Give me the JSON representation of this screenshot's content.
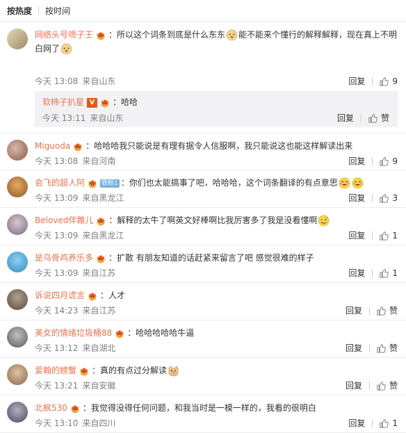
{
  "sort": {
    "hot": "按热度",
    "time": "按时间"
  },
  "labels": {
    "reply": "回复",
    "like": "赞"
  },
  "colors": {
    "username": "#eb7350",
    "meta": "#808080",
    "divider": "#ececec"
  },
  "comments": [
    {
      "user": "网络头号喷子王",
      "parts": [
        "所以这个词条到底是什么东东",
        "能不能来个懂行的解释解释，现在真上不明白网了"
      ],
      "emojis": [
        "doge-emoji",
        "doge-emoji"
      ],
      "time": "今天 13:08",
      "loc": "来自山东",
      "likes": "9",
      "reply": {
        "user": "软柿子扒星",
        "text": "：哈哈",
        "time": "今天 13:11",
        "loc": "来自山东"
      }
    },
    {
      "user": "Miguoda",
      "parts": [
        "：哈哈哈我只能说是有理有据令人信服啊，我只能说这也能这样解读出来"
      ],
      "time": "今天 13:08",
      "loc": "来自河南",
      "likes": "9"
    },
    {
      "user": "会飞的超人阿",
      "tag": "铁粉1",
      "parts": [
        "：你们也太能搞事了吧，哈哈哈，这个词条翻译的有点意思"
      ],
      "emojis": [
        "laugh-cry-emoji",
        "laugh-cry-emoji"
      ],
      "time": "今天 13:09",
      "loc": "来自黑龙江",
      "likes": "3"
    },
    {
      "user": "Beloved伴雛儿",
      "parts": [
        "：解释的太牛了啊英文好棒啊比我厉害多了我是没看懂啊"
      ],
      "emojis": [
        "sweat-emoji"
      ],
      "time": "今天 13:09",
      "loc": "来自黑龙江",
      "likes": "1"
    },
    {
      "user": "是乌骨鸡养乐多",
      "parts": [
        "：扩散 有朋友知道的话赶紧来留言了吧 感觉很难的样子"
      ],
      "time": "今天 13:09",
      "loc": "来自江苏",
      "likes": "1"
    },
    {
      "user": "诉说四月谎言",
      "parts": [
        "：人才"
      ],
      "time": "今天 14:23",
      "loc": "来自江苏",
      "likes": "赞"
    },
    {
      "user": "美女的情绪垃圾桶88",
      "parts": [
        "：哈哈哈哈哈牛逼"
      ],
      "time": "今天 13:12",
      "loc": "来自湖北",
      "likes": "赞"
    },
    {
      "user": "爱翰的螃蟹",
      "parts": [
        "：真的有点过分解读"
      ],
      "emojis": [
        "cat-emoji"
      ],
      "time": "今天 13:21",
      "loc": "来自安徽",
      "likes": "赞"
    },
    {
      "user": "北枫530",
      "parts": [
        "：我觉得没得任何问题，和我当时是一模一样的，我看的很明白"
      ],
      "time": "今天 13:10",
      "loc": "来自四川",
      "likes": "1"
    }
  ]
}
